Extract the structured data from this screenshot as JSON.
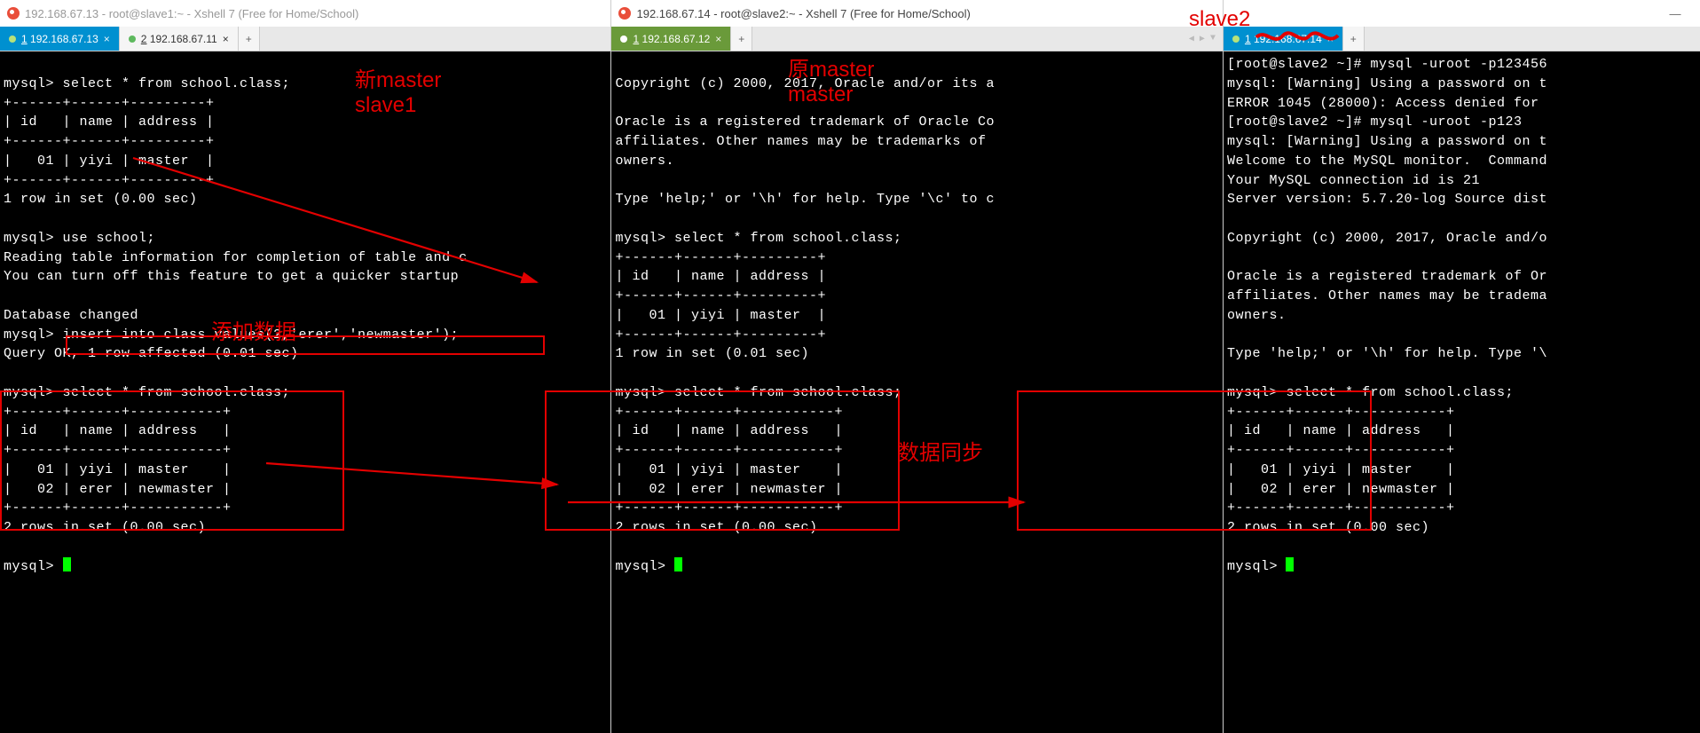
{
  "windows": [
    {
      "id": "w1",
      "title": "192.168.67.13 - root@slave1:~ - Xshell 7 (Free for Home/School)",
      "active": false,
      "win_controls": {
        "min": "—"
      },
      "tabs": [
        {
          "label": "1 192.168.67.13",
          "num": "1",
          "addr": "192.168.67.13",
          "style": "active"
        },
        {
          "label": "2 192.168.67.11",
          "num": "2",
          "addr": "192.168.67.11",
          "style": "idle"
        },
        {
          "label": "+",
          "style": "add"
        }
      ],
      "terminal": "\nmysql> select * from school.class;\n+------+------+---------+\n| id   | name | address |\n+------+------+---------+\n|   01 | yiyi | master  |\n+------+------+---------+\n1 row in set (0.00 sec)\n\nmysql> use school;\nReading table information for completion of table and c\nYou can turn off this feature to get a quicker startup \n\nDatabase changed\nmysql> insert into class values(2,'erer','newmaster');\nQuery OK, 1 row affected (0.01 sec)\n\nmysql> select * from school.class;\n+------+------+-----------+\n| id   | name | address   |\n+------+------+-----------+\n|   01 | yiyi | master    |\n|   02 | erer | newmaster |\n+------+------+-----------+\n2 rows in set (0.00 sec)\n\nmysql> "
    },
    {
      "id": "w2",
      "title": "192.168.67.14 - root@slave2:~ - Xshell 7 (Free for Home/School)",
      "active": true,
      "win_controls": {
        "min": "—"
      },
      "tabs": [
        {
          "label": "1 192.168.67.12",
          "num": "1",
          "addr": "192.168.67.12",
          "style": "green"
        },
        {
          "label": "+",
          "style": "add"
        }
      ],
      "tab_nav": true,
      "terminal": "\nCopyright (c) 2000, 2017, Oracle and/or its a\n\nOracle is a registered trademark of Oracle Co\naffiliates. Other names may be trademarks of \nowners.\n\nType 'help;' or '\\h' for help. Type '\\c' to c\n\nmysql> select * from school.class;\n+------+------+---------+\n| id   | name | address |\n+------+------+---------+\n|   01 | yiyi | master  |\n+------+------+---------+\n1 row in set (0.01 sec)\n\nmysql> select * from school.class;\n+------+------+-----------+\n| id   | name | address   |\n+------+------+-----------+\n|   01 | yiyi | master    |\n|   02 | erer | newmaster |\n+------+------+-----------+\n2 rows in set (0.00 sec)\n\nmysql> "
    },
    {
      "id": "w3",
      "tabs": [
        {
          "label": "1 192.168.67.14",
          "num": "1",
          "addr": "192.168.67.14",
          "style": "active"
        },
        {
          "label": "+",
          "style": "add"
        }
      ],
      "terminal": "[root@slave2 ~]# mysql -uroot -p123456\nmysql: [Warning] Using a password on t\nERROR 1045 (28000): Access denied for \n[root@slave2 ~]# mysql -uroot -p123\nmysql: [Warning] Using a password on t\nWelcome to the MySQL monitor.  Command\nYour MySQL connection id is 21\nServer version: 5.7.20-log Source dist\n\nCopyright (c) 2000, 2017, Oracle and/o\n\nOracle is a registered trademark of Or\naffiliates. Other names may be tradema\nowners.\n\nType 'help;' or '\\h' for help. Type '\\\n\nmysql> select * from school.class;\n+------+------+-----------+\n| id   | name | address   |\n+------+------+-----------+\n|   01 | yiyi | master    |\n|   02 | erer | newmaster |\n+------+------+-----------+\n2 rows in set (0.00 sec)\n\nmysql> "
    }
  ],
  "annotations": {
    "new_master_line1": "新master",
    "new_master_line2": "slave1",
    "old_master_line1": "原master",
    "old_master_line2": "master",
    "slave2_label": "slave2",
    "add_data": "添加数据",
    "data_sync": "数据同步"
  },
  "colors": {
    "annotation_red": "#e30000",
    "tab_blue": "#0090d0",
    "tab_green": "#6a9a3a"
  }
}
